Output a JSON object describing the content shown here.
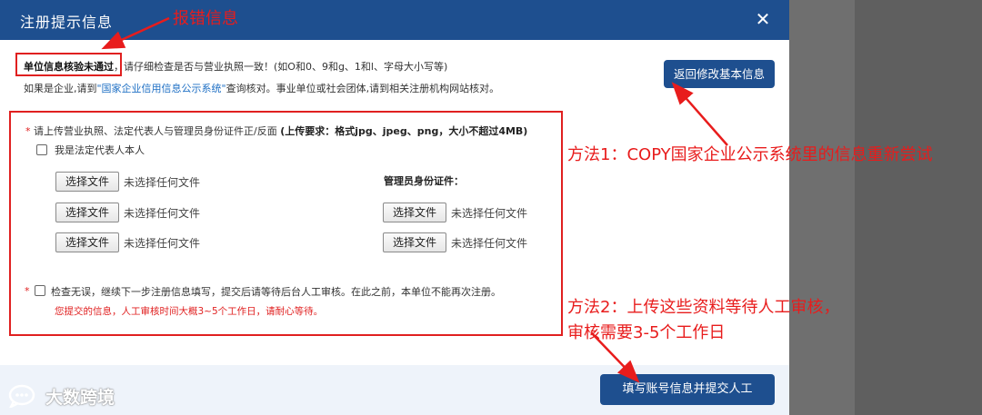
{
  "dialog": {
    "title": "注册提示信息",
    "close_label": "✕"
  },
  "error": {
    "headline": "单位信息核验未通过",
    "detail": "，请仔细检查是否与营业执照一致！(如O和0、9和g、1和l、字母大小写等)",
    "line2_prefix": "如果是企业,请到",
    "line2_link": "\"国家企业信用信息公示系统\"",
    "line2_suffix": "查询核对。事业单位或社会团体,请到相关注册机构网站核对。",
    "back_button": "返回修改基本信息"
  },
  "upload": {
    "star": "*",
    "requirement": "请上传营业执照、法定代表人与管理员身份证件正/反面",
    "requirement_bold": "(上传要求：格式jpg、jpeg、png，大小不超过4MB)",
    "legal_rep_label": "我是法定代表人本人",
    "admin_id_label": "管理员身份证件：",
    "choose_file": "选择文件",
    "no_file": "未选择任何文件"
  },
  "confirm": {
    "star": "*",
    "text": "检查无误，继续下一步注册信息填写，提交后请等待后台人工审核。在此之前，本单位不能再次注册。",
    "warning": "您提交的信息，人工审核时间大概3~5个工作日，请耐心等待。"
  },
  "submit_button": "填写账号信息并提交人工",
  "annotations": {
    "error_label": "报错信息",
    "method1": "方法1：COPY国家企业公示系统里的信息重新尝试",
    "method2_line1": "方法2：上传这些资料等待人工审核，",
    "method2_line2": "审核需要3-5个工作日"
  },
  "watermark": {
    "text": "大数跨境",
    "logo_icon": "chat-bubble-logo-icon"
  },
  "colors": {
    "header_blue": "#1e4f8f",
    "annotation_red": "#e81c1c",
    "link_blue": "#1e6fc4"
  }
}
